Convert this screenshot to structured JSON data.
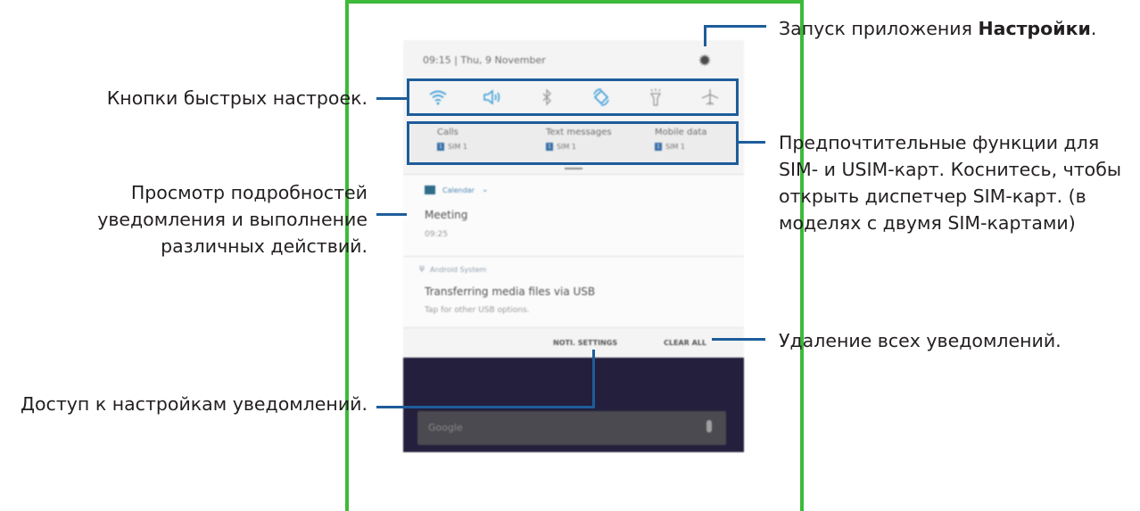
{
  "phone": {
    "status_text": "09:15 | Thu, 9 November",
    "quick_icons": [
      "wifi-icon",
      "sound-icon",
      "bluetooth-icon",
      "auto-rotate-icon",
      "flashlight-icon",
      "airplane-icon"
    ],
    "sim": [
      {
        "title": "Calls",
        "sub": "SIM 1",
        "badge": "1"
      },
      {
        "title": "Text messages",
        "sub": "SIM 1",
        "badge": "1"
      },
      {
        "title": "Mobile data",
        "sub": "SIM 1",
        "badge": "1"
      }
    ],
    "notif1": {
      "app": "Calendar",
      "title": "Meeting",
      "sub": "09:25"
    },
    "notif2": {
      "app": "Android System",
      "title": "Transferring media files via USB",
      "sub": "Tap for other USB options."
    },
    "actions": {
      "noti_settings": "NOTI. SETTINGS",
      "clear_all": "CLEAR ALL"
    },
    "search": {
      "text": "Google"
    }
  },
  "annotations": {
    "settings_prefix": "Запуск приложения ",
    "settings_bold": "Настройки",
    "settings_suffix": ".",
    "quick": "Кнопки быстрых настроек.",
    "sim_line1": "Предпочтительные функции для",
    "sim_line2": "SIM- и USIM-карт. Коснитесь, чтобы",
    "sim_line3": "открыть диспетчер SIM-карт. (в",
    "sim_line4": "моделях с двумя SIM-картами)",
    "details_line1": "Просмотр подробностей",
    "details_line2": "уведомления и выполнение",
    "details_line3": "различных действий.",
    "clear": "Удаление всех уведомлений.",
    "noti_settings": "Доступ к настройкам уведомлений."
  },
  "colors": {
    "frame": "#3dba3a",
    "callout": "#1d5d9b",
    "quick_icon": "#3a9bd8"
  }
}
